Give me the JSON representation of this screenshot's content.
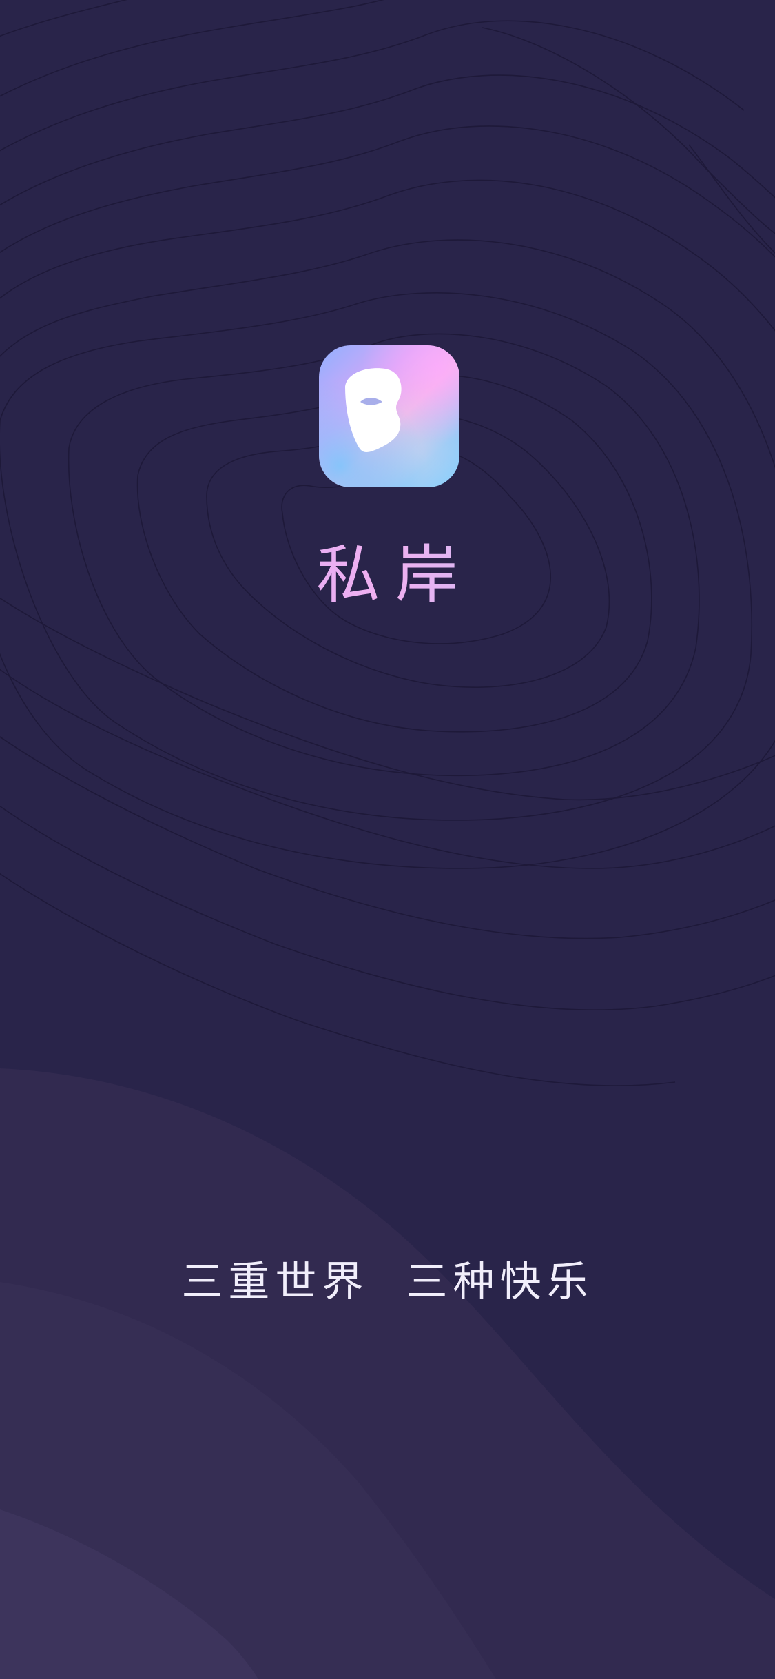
{
  "app": {
    "name": "私岸",
    "slogan": "三重世界  三种快乐"
  },
  "colors": {
    "background": "#29244a",
    "wave_light_1": "#322a50",
    "wave_light_2": "#3a3258",
    "contour_line": "#1d1838",
    "icon_gradient": [
      "#8fb0ff",
      "#f3b9e6",
      "#7fd0ff"
    ]
  },
  "icons": {
    "app_icon": "mask-logo-icon"
  }
}
